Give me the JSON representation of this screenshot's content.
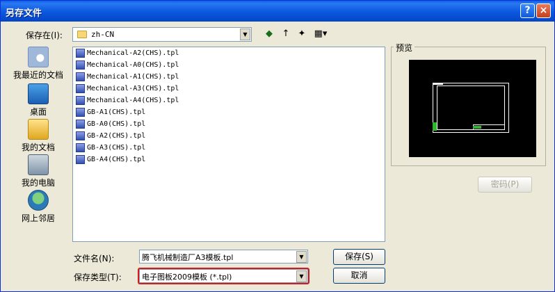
{
  "window": {
    "title": "另存文件",
    "help_glyph": "?",
    "close_glyph": "×"
  },
  "lookin": {
    "label": "保存在(I):",
    "value": "zh-CN"
  },
  "toolbar": {
    "back": "◆",
    "up": "↑",
    "new_folder": "✦",
    "views": "▦▾"
  },
  "places": [
    {
      "name": "recent",
      "label": "我最近的文档"
    },
    {
      "name": "desktop",
      "label": "桌面"
    },
    {
      "name": "documents",
      "label": "我的文档"
    },
    {
      "name": "computer",
      "label": "我的电脑"
    },
    {
      "name": "network",
      "label": "网上邻居"
    }
  ],
  "files": [
    "Mechanical-A2(CHS).tpl",
    "Mechanical-A0(CHS).tpl",
    "Mechanical-A1(CHS).tpl",
    "Mechanical-A3(CHS).tpl",
    "Mechanical-A4(CHS).tpl",
    "GB-A1(CHS).tpl",
    "GB-A0(CHS).tpl",
    "GB-A2(CHS).tpl",
    "GB-A3(CHS).tpl",
    "GB-A4(CHS).tpl"
  ],
  "preview": {
    "label": "预览"
  },
  "password_button": "密码(P)",
  "filename": {
    "label": "文件名(N):",
    "value": "腾飞机械制造厂A3模板.tpl"
  },
  "filetype": {
    "label": "保存类型(T):",
    "value": "电子图板2009模板 (*.tpl)"
  },
  "save_button": "保存(S)",
  "cancel_button": "取消",
  "colors": {
    "title_bar": "#0a58de",
    "highlight": "#d81a1a"
  }
}
